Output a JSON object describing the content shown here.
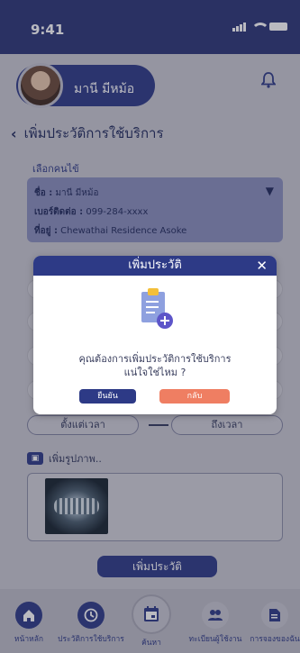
{
  "status": {
    "time": "9:41"
  },
  "profile": {
    "name": "มานี มีหม้อ"
  },
  "page": {
    "title": "เพิ่มประวัติการใช้บริการ"
  },
  "form": {
    "select_label": "เลือกคนไข้",
    "patient": {
      "name_label": "ชื่อ :",
      "name_value": "มานี มีหม้อ",
      "phone_label": "เบอร์ติดต่อ :",
      "phone_value": "099-284-xxxx",
      "address_label": "ที่อยู่ :",
      "address_value": "Chewathai Residence Asoke"
    },
    "time_from_placeholder": "ตั้งแต่เวลา",
    "time_to_placeholder": "ถึงเวลา",
    "add_photo_label": "เพิ่มรูปภาพ..",
    "submit_label": "เพิ่มประวัติ"
  },
  "modal": {
    "title": "เพิ่มประวัติ",
    "close_glyph": "✕",
    "message_line1": "คุณต้องการเพิ่มประวัติการใช้บริการ",
    "message_line2": "แน่ใจใช่ไหม ?",
    "confirm_label": "ยืนยัน",
    "back_label": "กลับ"
  },
  "nav": {
    "home": "หน้าหลัก",
    "history": "ประวัติการใช้บริการ",
    "search": "ค้นหา",
    "register": "ทะเบียนผู้ใช้งาน",
    "booking": "การจองของฉัน"
  },
  "icons": {
    "home": "home-icon",
    "history": "history-icon",
    "search": "calendar-icon",
    "register": "users-icon",
    "booking": "document-icon"
  },
  "colors": {
    "primary": "#2d3a86",
    "danger": "#ef7e62"
  }
}
